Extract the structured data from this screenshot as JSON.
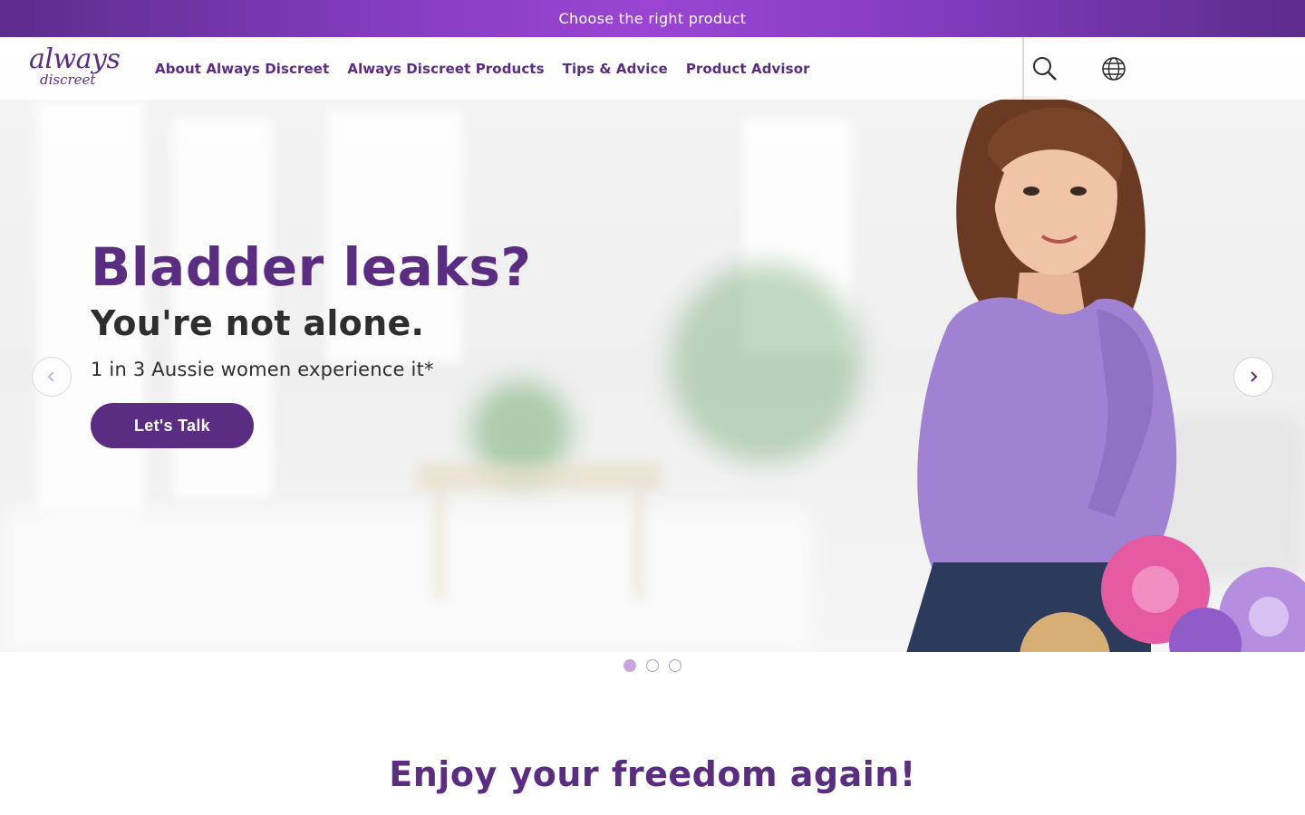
{
  "promo": {
    "label": "Choose the right product"
  },
  "header": {
    "logo_top": "always",
    "logo_bottom": "discreet",
    "nav": [
      {
        "label": "About Always Discreet"
      },
      {
        "label": "Always Discreet Products"
      },
      {
        "label": "Tips & Advice"
      },
      {
        "label": "Product Advisor"
      }
    ],
    "icons": {
      "search": "search-icon",
      "locale": "globe-icon"
    }
  },
  "hero": {
    "title": "Bladder leaks?",
    "subtitle": "You're not alone.",
    "stat": "1 in 3 Aussie women experience it*",
    "cta_label": "Let's Talk",
    "slides_total": 3,
    "active_slide": 1
  },
  "section": {
    "title": "Enjoy your freedom again!"
  },
  "colors": {
    "brand_purple": "#5a2d82",
    "promo_gradient_center": "#9a45d2",
    "dot_active": "#c7a6df"
  }
}
